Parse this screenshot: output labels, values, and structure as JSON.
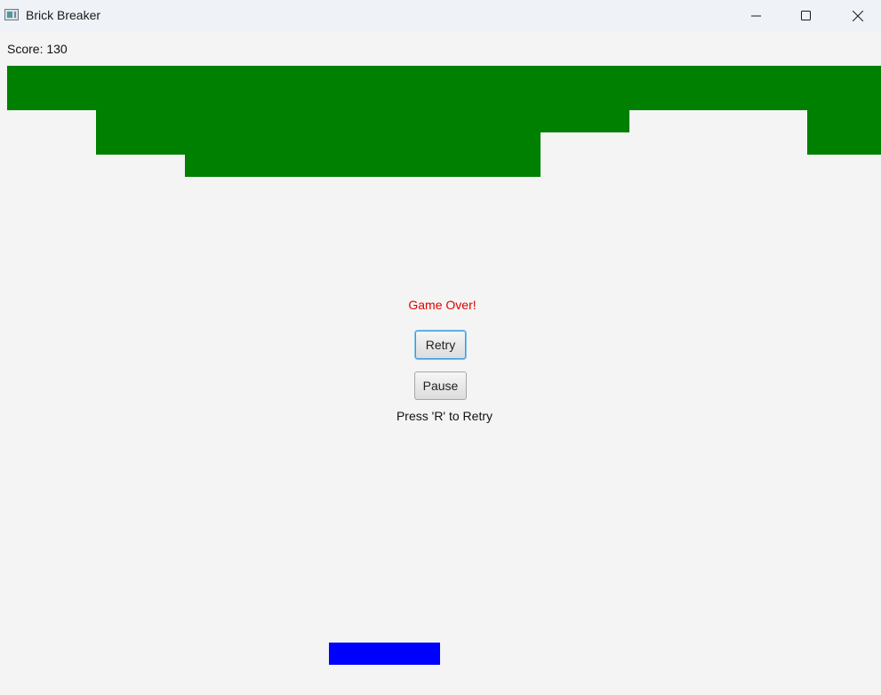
{
  "window": {
    "title": "Brick Breaker",
    "controls": [
      "minimize-icon",
      "maximize-icon",
      "close-icon"
    ]
  },
  "game": {
    "score_text": "Score: 130",
    "game_over_text": "Game Over!",
    "retry_label": "Retry",
    "pause_label": "Pause",
    "hint_text": "Press 'R' to Retry"
  },
  "colors": {
    "brick": "#008000",
    "paddle": "#0000ff",
    "game_over": "#e00000",
    "background": "#f4f4f4"
  }
}
